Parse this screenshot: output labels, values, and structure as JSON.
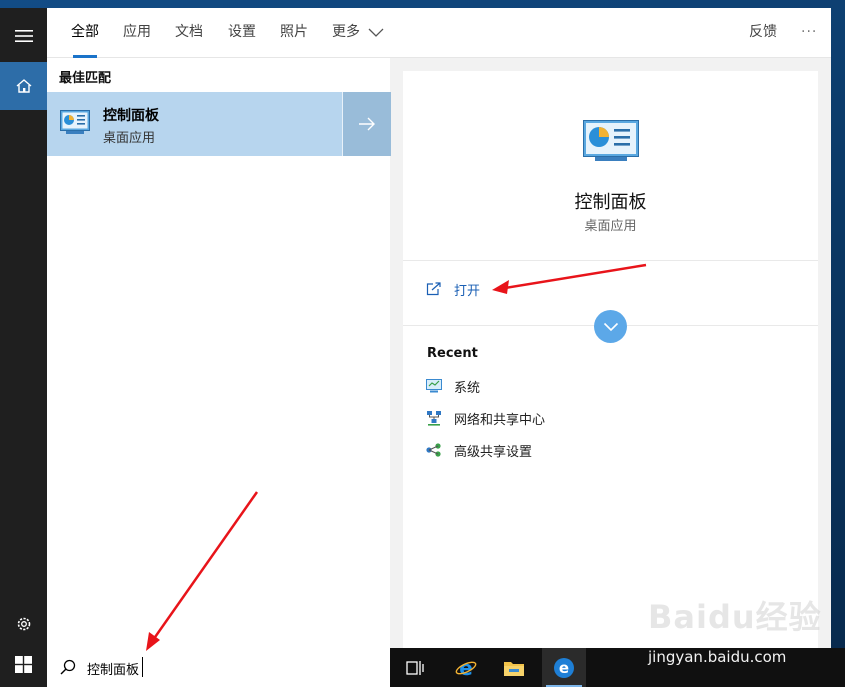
{
  "tabs": [
    {
      "label": "全部",
      "active": true
    },
    {
      "label": "应用"
    },
    {
      "label": "文档"
    },
    {
      "label": "设置"
    },
    {
      "label": "照片"
    },
    {
      "label": "更多"
    }
  ],
  "header": {
    "feedback_label": "反馈",
    "overflow_label": "···"
  },
  "results": {
    "section_title": "最佳匹配",
    "best_match": {
      "name": "控制面板",
      "type": "桌面应用"
    }
  },
  "detail": {
    "name": "控制面板",
    "type": "桌面应用",
    "open_label": "打开",
    "recent_title": "Recent",
    "recent_items": [
      {
        "label": "系统",
        "icon": "system-icon"
      },
      {
        "label": "网络和共享中心",
        "icon": "network-icon"
      },
      {
        "label": "高级共享设置",
        "icon": "sharing-icon"
      }
    ]
  },
  "search": {
    "value": "控制面板"
  },
  "watermark": {
    "brand": "Baidu经验",
    "url": "jingyan.baidu.com"
  },
  "colors": {
    "accent": "#1a73c9",
    "result_highlight": "#b7d5ee",
    "sidebar": "#1f1f1f",
    "taskbar": "#101010",
    "annotation_arrow": "#e8141a"
  }
}
